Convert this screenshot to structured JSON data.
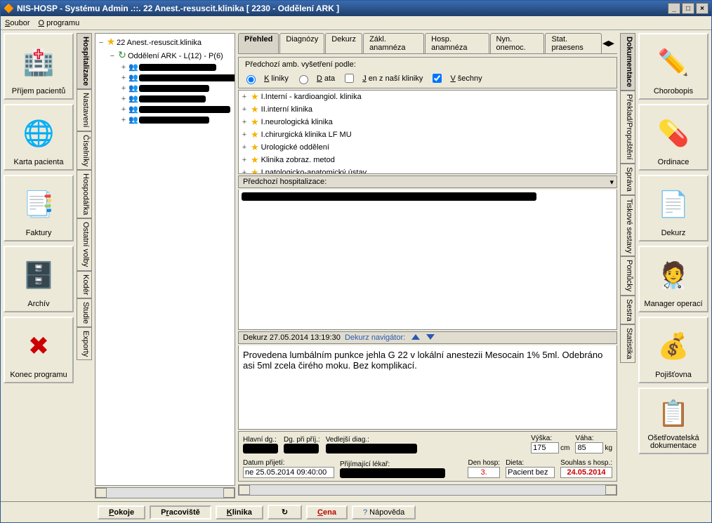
{
  "title": "NIS-HOSP -  Systému Admin  .::.  22 Anest.-resuscit.klinika    [ 2230 - Oddělení ARK ]",
  "menu": {
    "soubor": "Soubor",
    "oprogramu": "O programu"
  },
  "left_buttons": [
    {
      "id": "prijem",
      "label": "Příjem pacientů",
      "icon": "🏥"
    },
    {
      "id": "karta",
      "label": "Karta pacienta",
      "icon": "🌐"
    },
    {
      "id": "faktury",
      "label": "Faktury",
      "icon": "📑"
    },
    {
      "id": "archiv",
      "label": "Archív",
      "icon": "🗄️"
    },
    {
      "id": "konec",
      "label": "Konec programu",
      "icon": "✖"
    }
  ],
  "right_buttons": [
    {
      "id": "chorobopis",
      "label": "Chorobopis",
      "icon": "✏️"
    },
    {
      "id": "ordinace",
      "label": "Ordinace",
      "icon": "💊"
    },
    {
      "id": "dekurz",
      "label": "Dekurz",
      "icon": "📄"
    },
    {
      "id": "manager",
      "label": "Manager operací",
      "icon": "🧑‍⚕️"
    },
    {
      "id": "pojistovna",
      "label": "Pojišťovna",
      "icon": "💰"
    },
    {
      "id": "osetrovatelska",
      "label": "Ošetřovatelská dokumentace",
      "icon": "📋"
    }
  ],
  "left_vtabs": [
    "Hospitalizace",
    "Nastavení",
    "Číselníky",
    "Hospodářka",
    "Ostatní volby",
    "Kodér",
    "Studie",
    "Exporty"
  ],
  "right_vtabs": [
    "Dokumentace",
    "Překlad/Propuštění",
    "Správa",
    "Tiskové sestavy",
    "Pomůcky",
    "Sestra",
    "Statistika"
  ],
  "tree": {
    "root": "22 Anest.-resuscit.klinika",
    "dept": "Oddělení ARK - L(12) - P(6)",
    "patients_count": 6
  },
  "tabs": [
    "Přehled",
    "Diagnózy",
    "Dekurz",
    "Zákl. anamnéza",
    "Hosp. anamnéza",
    "Nyn. onemoc.",
    "Stat. praesens"
  ],
  "active_tab": 0,
  "filter": {
    "title": "Předchozí amb. vyšetření podle:",
    "kliniky": "Kliniky",
    "data": "Data",
    "jen_z_nasi": "Jen z naší kliniky",
    "vsechny": "Všechny"
  },
  "clinics": [
    "I.Interní - kardioangiol. klinika",
    "II.interní klinika",
    "I.neurologická klinika",
    "I.chirurgická klinika LF MU",
    "Urologické oddělení",
    "Klinika zobraz. metod",
    "I.patologicko-anatomický ústav"
  ],
  "hosp_header": "Předchozí hospitalizace:",
  "dekurz": {
    "header_prefix": "Dekurz 27.05.2014 13:19:30",
    "nav_label": "Dekurz navigátor:",
    "text": "Provedena lumbálním punkce jehla G 22 v lokální anestezii Mesocain 1% 5ml. Odebráno asi 5ml zcela čirého moku. Bez komplikací."
  },
  "form": {
    "hlavni_dg_label": "Hlavní dg.:",
    "dg_pri_prij_label": "Dg. při příj.:",
    "vedlejsi_diag_label": "Vedlejší diag.:",
    "vyska_label": "Výška:",
    "vaha_label": "Váha:",
    "vyska": "175",
    "vyska_unit": "cm",
    "vaha": "85",
    "vaha_unit": "kg",
    "datum_prijeti_label": "Datum přijetí:",
    "datum_prijeti": "ne 25.05.2014 09:40:00",
    "prijimajici_lekar_label": "Přijímající lékař:",
    "den_hosp_label": "Den hosp:",
    "den_hosp": "3.",
    "dieta_label": "Dieta:",
    "dieta": "Pacient bez",
    "souhlas_label": "Souhlas s hosp.:",
    "souhlas": "24.05.2014"
  },
  "bottom": {
    "pokoje": "Pokoje",
    "pracoviste": "Pracoviště",
    "klinika": "Klinika",
    "cena": "Cena",
    "napoveda": "Nápověda"
  }
}
